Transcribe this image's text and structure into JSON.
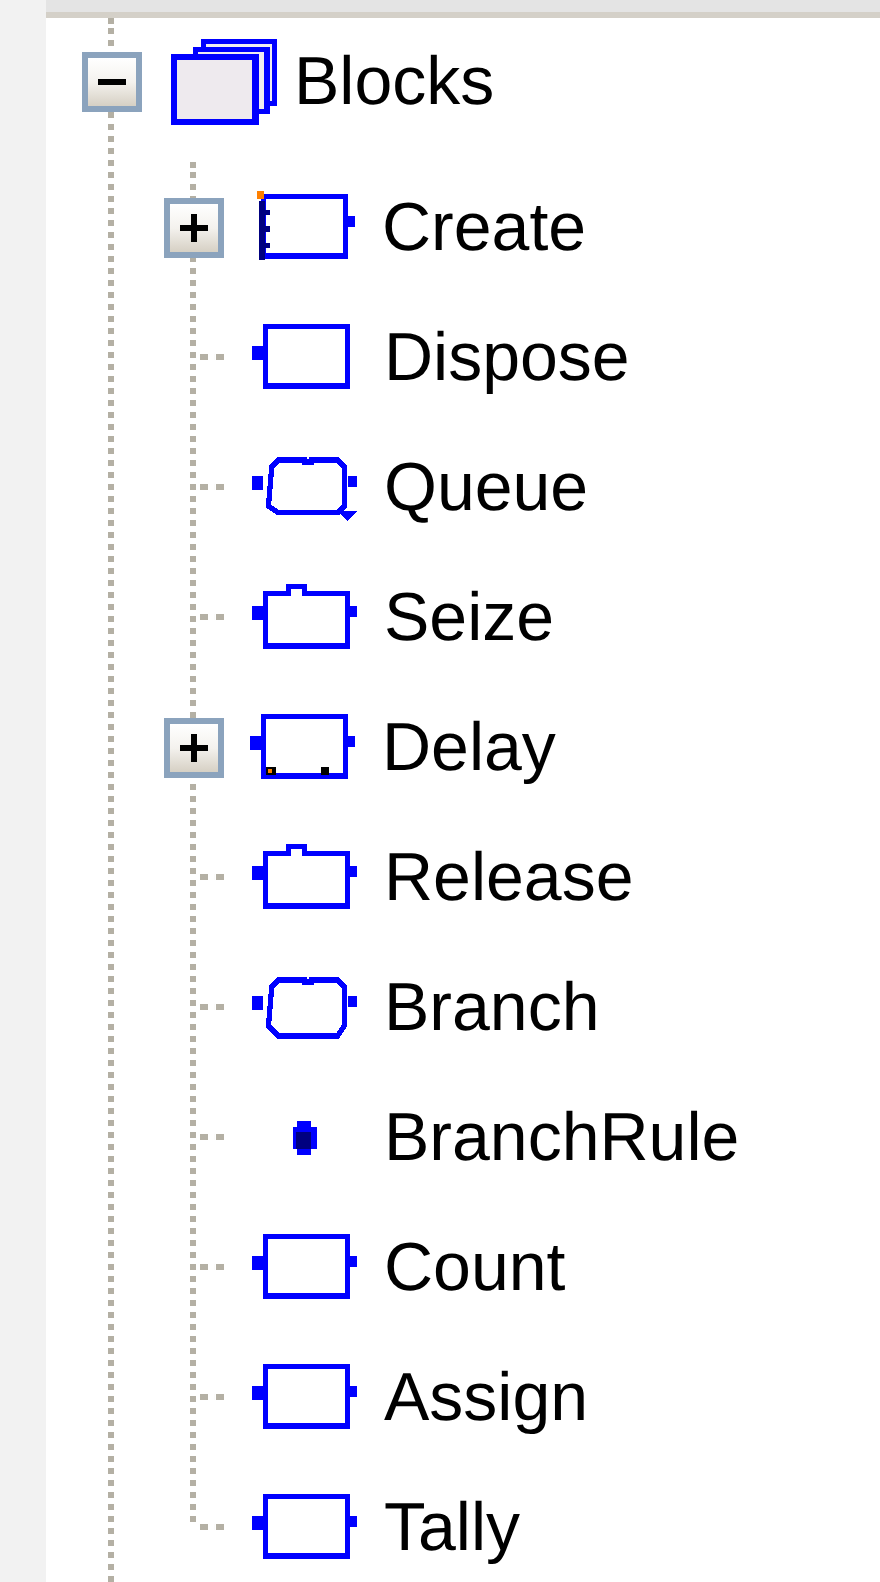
{
  "tree": {
    "label": "Blocks",
    "kind": "folder",
    "expanded": true,
    "children": [
      {
        "label": "Create",
        "kind": "create",
        "expanded": false
      },
      {
        "label": "Dispose",
        "kind": "dispose"
      },
      {
        "label": "Queue",
        "kind": "queue"
      },
      {
        "label": "Seize",
        "kind": "tabbed"
      },
      {
        "label": "Delay",
        "kind": "delay",
        "expanded": false
      },
      {
        "label": "Release",
        "kind": "tabbed"
      },
      {
        "label": "Branch",
        "kind": "rounded"
      },
      {
        "label": "BranchRule",
        "kind": "rule"
      },
      {
        "label": "Count",
        "kind": "module"
      },
      {
        "label": "Assign",
        "kind": "module"
      },
      {
        "label": "Tally",
        "kind": "module"
      }
    ]
  }
}
